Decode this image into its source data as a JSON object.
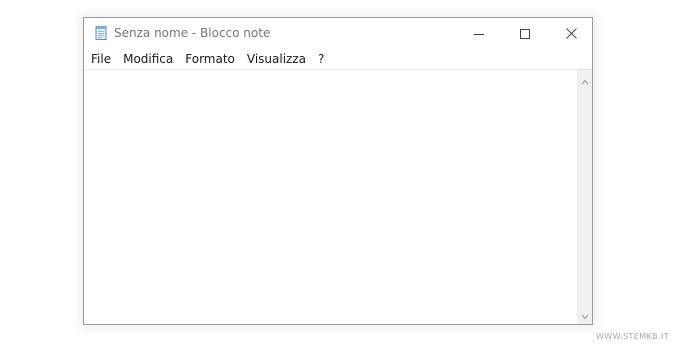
{
  "window": {
    "title": "Senza nome - Blocco note",
    "app_icon": "notepad-icon",
    "controls": {
      "minimize_icon": "minimize-icon",
      "maximize_icon": "maximize-icon",
      "close_icon": "close-icon"
    }
  },
  "menubar": {
    "items": [
      {
        "label": "File"
      },
      {
        "label": "Modifica"
      },
      {
        "label": "Formato"
      },
      {
        "label": "Visualizza"
      },
      {
        "label": "?"
      }
    ]
  },
  "editor": {
    "content": ""
  },
  "scrollbar": {
    "up_icon": "chevron-up-icon",
    "down_icon": "chevron-down-icon"
  },
  "watermark": "WWW.STEMKB.IT",
  "colors": {
    "window_border": "#9a9a9a",
    "title_text": "#777777",
    "menu_text": "#1a1a1a",
    "scrollbar_bg": "#f0f0f0"
  }
}
